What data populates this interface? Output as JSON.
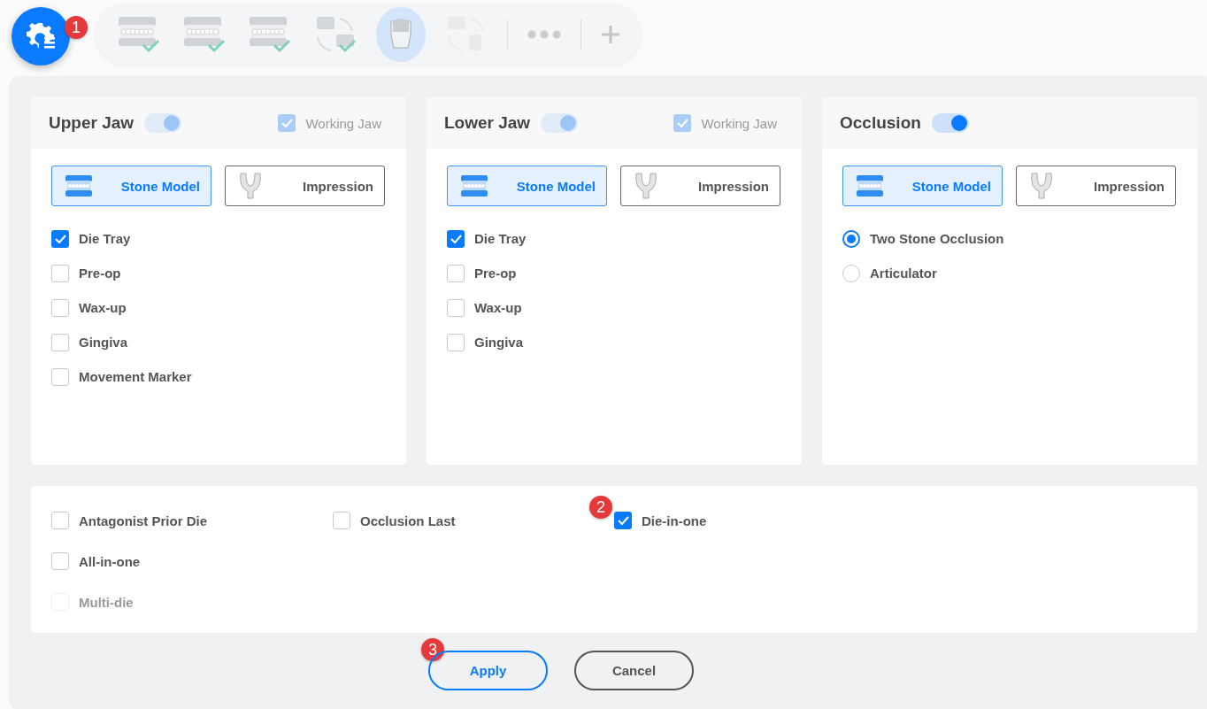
{
  "toolbar": {
    "settings_badge": "1",
    "steps": [
      {
        "kind": "upper",
        "done": true,
        "selected": false,
        "disabled": false
      },
      {
        "kind": "lower",
        "done": true,
        "selected": false,
        "disabled": false
      },
      {
        "kind": "both",
        "done": true,
        "selected": false,
        "disabled": false
      },
      {
        "kind": "occlusion",
        "done": true,
        "selected": false,
        "disabled": false
      },
      {
        "kind": "die",
        "done": false,
        "selected": true,
        "disabled": false
      },
      {
        "kind": "die-occlusion",
        "done": false,
        "selected": false,
        "disabled": true
      }
    ]
  },
  "panels": [
    {
      "title": "Upper Jaw",
      "toggle": {
        "on": true,
        "disabled": true
      },
      "working_jaw": {
        "label": "Working Jaw",
        "checked": true,
        "disabled": true
      },
      "model_types": [
        {
          "kind": "stone",
          "label": "Stone Model",
          "selected": true
        },
        {
          "kind": "impression",
          "label": "Impression",
          "selected": false
        }
      ],
      "options": [
        {
          "kind": "checkbox",
          "label": "Die Tray",
          "checked": true
        },
        {
          "kind": "checkbox",
          "label": "Pre-op",
          "checked": false
        },
        {
          "kind": "checkbox",
          "label": "Wax-up",
          "checked": false
        },
        {
          "kind": "checkbox",
          "label": "Gingiva",
          "checked": false
        },
        {
          "kind": "checkbox",
          "label": "Movement Marker",
          "checked": false
        }
      ]
    },
    {
      "title": "Lower Jaw",
      "toggle": {
        "on": true,
        "disabled": true
      },
      "working_jaw": {
        "label": "Working Jaw",
        "checked": true,
        "disabled": true
      },
      "model_types": [
        {
          "kind": "stone",
          "label": "Stone Model",
          "selected": true
        },
        {
          "kind": "impression",
          "label": "Impression",
          "selected": false
        }
      ],
      "options": [
        {
          "kind": "checkbox",
          "label": "Die Tray",
          "checked": true
        },
        {
          "kind": "checkbox",
          "label": "Pre-op",
          "checked": false
        },
        {
          "kind": "checkbox",
          "label": "Wax-up",
          "checked": false
        },
        {
          "kind": "checkbox",
          "label": "Gingiva",
          "checked": false
        }
      ]
    },
    {
      "title": "Occlusion",
      "toggle": {
        "on": true,
        "disabled": false
      },
      "model_types": [
        {
          "kind": "stone",
          "label": "Stone Model",
          "selected": true
        },
        {
          "kind": "impression",
          "label": "Impression",
          "selected": false
        }
      ],
      "options": [
        {
          "kind": "radio",
          "label": "Two Stone Occlusion",
          "selected": true
        },
        {
          "kind": "radio",
          "label": "Articulator",
          "selected": false
        }
      ]
    }
  ],
  "option_rows": [
    [
      {
        "label": "Antagonist Prior Die",
        "checked": false,
        "disabled": false
      },
      {
        "label": "Occlusion Last",
        "checked": false,
        "disabled": false
      },
      {
        "label": "Die-in-one",
        "checked": true,
        "disabled": false,
        "badge": "2"
      }
    ],
    [
      {
        "label": "All-in-one",
        "checked": false,
        "disabled": false
      }
    ],
    [
      {
        "label": "Multi-die",
        "checked": false,
        "disabled": true
      }
    ]
  ],
  "buttons": [
    {
      "kind": "primary",
      "label": "Apply",
      "badge": "3"
    },
    {
      "kind": "secondary",
      "label": "Cancel"
    }
  ]
}
